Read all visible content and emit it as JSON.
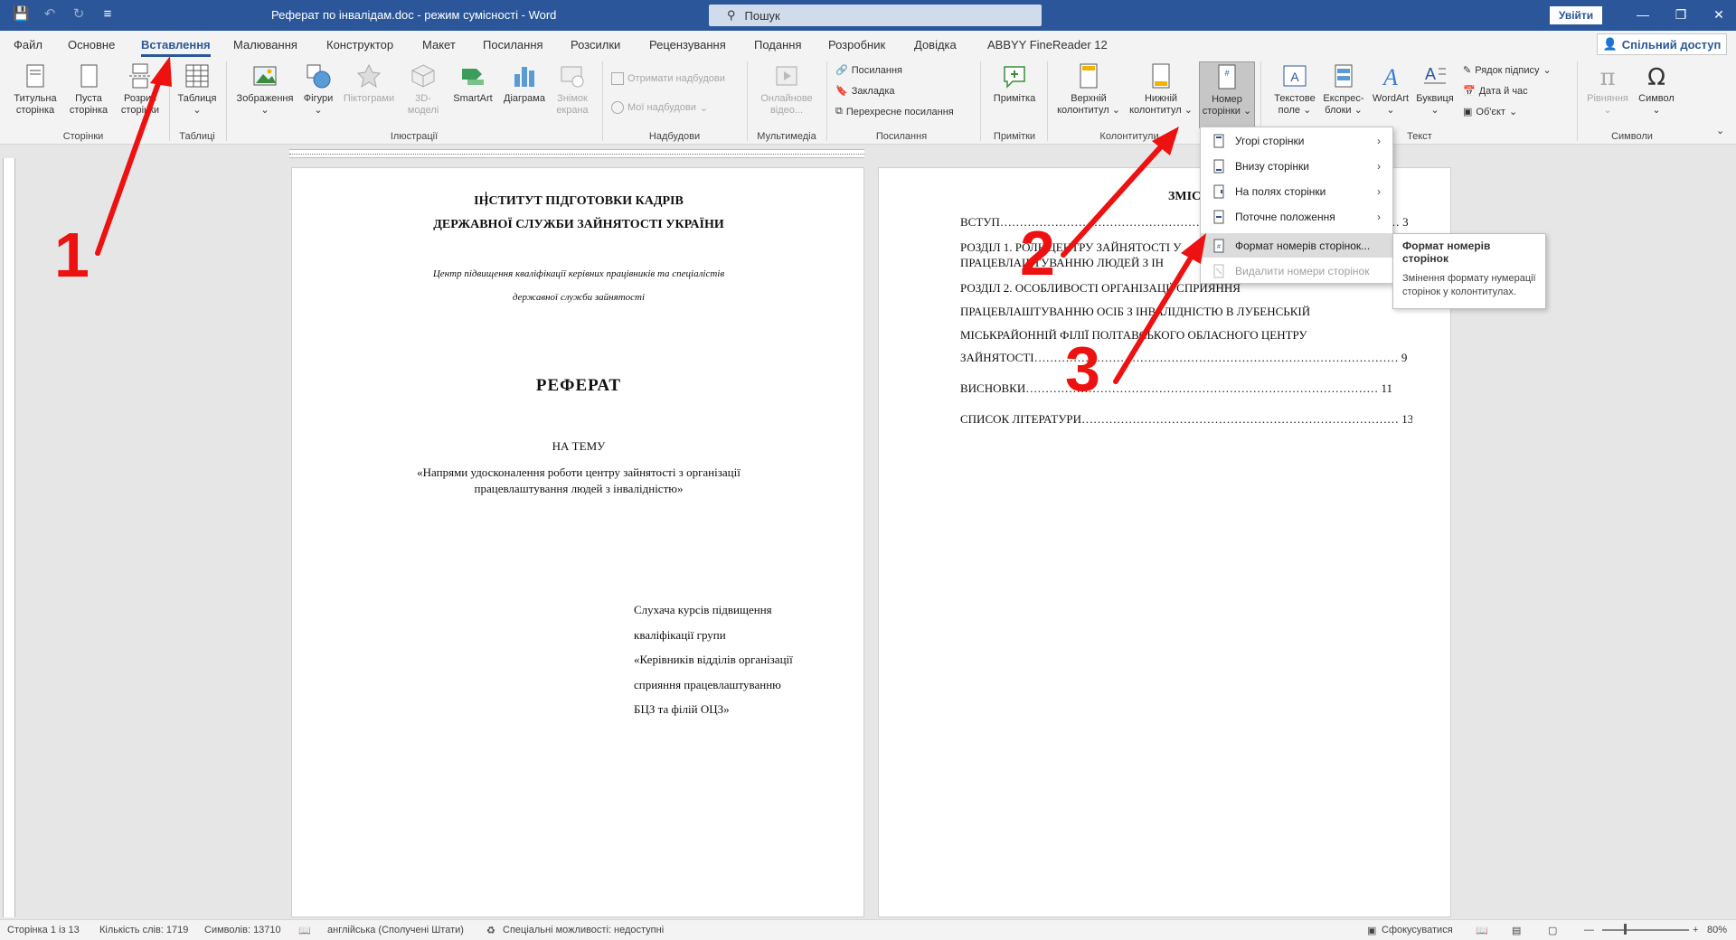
{
  "titlebar": {
    "doc_title": "Реферат по інвалідам.doc  -  режим сумісності  -  Word",
    "search_placeholder": "Пошук",
    "signin": "Увійти"
  },
  "tabs": [
    "Файл",
    "Основне",
    "Вставлення",
    "Малювання",
    "Конструктор",
    "Макет",
    "Посилання",
    "Розсилки",
    "Рецензування",
    "Подання",
    "Розробник",
    "Довідка",
    "ABBYY FineReader 12"
  ],
  "share": "Спільний доступ",
  "ribbon": {
    "pages": {
      "title_page": [
        "Титульна",
        "сторінка"
      ],
      "blank_page": [
        "Пуста",
        "сторінка"
      ],
      "page_break": [
        "Розрив",
        "сторінки"
      ],
      "group": "Сторінки"
    },
    "tables": {
      "table": "Таблиця",
      "group": "Таблиці"
    },
    "illustrations": {
      "pictures": "Зображення",
      "shapes": "Фігури",
      "icons": "Піктограми",
      "models": [
        "3D-",
        "моделі"
      ],
      "smartart": "SmartArt",
      "chart": "Діаграма",
      "screenshot": [
        "Знімок",
        "екрана"
      ],
      "group": "Ілюстрації"
    },
    "addins": {
      "get": "Отримати надбудови",
      "my": "Мої надбудови",
      "group": "Надбудови"
    },
    "media": {
      "online_video": [
        "Онлайнове",
        "відео..."
      ],
      "group": "Мультимедіа"
    },
    "links": {
      "link": "Посилання",
      "bookmark": "Закладка",
      "crossref": "Перехресне посилання",
      "group": "Посилання"
    },
    "comments": {
      "comment": "Примітка",
      "group": "Примітки"
    },
    "header_footer": {
      "header": [
        "Верхній",
        "колонтитул"
      ],
      "footer": [
        "Нижній",
        "колонтитул"
      ],
      "page_number": [
        "Номер",
        "сторінки"
      ],
      "group": "Колонтитули"
    },
    "text": {
      "textbox": [
        "Текстове",
        "поле"
      ],
      "quickparts": [
        "Експрес-",
        "блоки"
      ],
      "wordart": "WordArt",
      "dropcap": "Буквиця",
      "sigline": "Рядок підпису",
      "datetime": "Дата й час",
      "object": "Об'єкт",
      "group": "Текст"
    },
    "symbols": {
      "equation": "Рівняння",
      "symbol": "Символ",
      "group": "Символи"
    }
  },
  "page1": {
    "institute": [
      "ІНСТИТУТ ПІДГОТОВКИ КАДРІВ",
      "ДЕРЖАВНОЇ СЛУЖБИ ЗАЙНЯТОСТІ УКРАЇНИ"
    ],
    "center": [
      "Центр підвищення кваліфікації керівних працівників та спеціалістів",
      "державної служби зайнятості"
    ],
    "title": "РЕФЕРАТ",
    "on_theme": "НА ТЕМУ",
    "topic": "«Напрями удосконалення роботи центру зайнятості з організації працевлаштування людей з інвалідністю»",
    "student": [
      "Слухача курсів підвищення",
      "кваліфікації групи",
      "«Керівників відділів організації",
      "сприяння працевлаштуванню",
      "БЦЗ та філій ОЦЗ»"
    ]
  },
  "page2": {
    "toc_title": "ЗМІСТ",
    "rows": [
      "ВСТУП………………………………………………………………………………………… 3",
      "РОЗДІЛ 1. РОЛЬ ЦЕНТРУ ЗАЙНЯТОСТІ У",
      "ПРАЦЕВЛАШТУВАННЮ ЛЮДЕЙ З ІН",
      "РОЗДІЛ 2. ОСОБЛИВОСТІ ОРГАНІЗАЦІЇ СПРИЯННЯ",
      "ПРАЦЕВЛАШТУВАННЮ ОСІБ З ІНВАЛІДНІСТЮ В ЛУБЕНСЬКІЙ",
      "МІСЬКРАЙОННІЙ ФІЛІЇ ПОЛТАВСЬКОГО ОБЛАСНОГО ЦЕНТРУ",
      "ЗАЙНЯТОСТІ………………………………………………………………………………… 9",
      "ВИСНОВКИ……………………………………………………………………………… 11",
      "СПИСОК ЛІТЕРАТУРИ……………………………………………………………………… 13"
    ]
  },
  "menu": {
    "items": [
      "Угорі сторінки",
      "Внизу сторінки",
      "На полях сторінки",
      "Поточне положення",
      "Формат номерів сторінок...",
      "Видалити номери сторінок"
    ],
    "tooltip_title": "Формат номерів сторінок",
    "tooltip_body": "Змінення формату нумерації сторінок у колонтитулах."
  },
  "annotations": [
    "1",
    "2",
    "3"
  ],
  "statusbar": {
    "page": "Сторінка 1 із 13",
    "words": "Кількість слів: 1719",
    "chars": "Символів: 13710",
    "lang": "англійська (Сполучені Штати)",
    "accessibility": "Спеціальні можливості: недоступні",
    "focus": "Сфокусуватися",
    "zoom": "80%"
  },
  "colors": {
    "accent": "#2b579a",
    "annotation": "#ee1111"
  }
}
